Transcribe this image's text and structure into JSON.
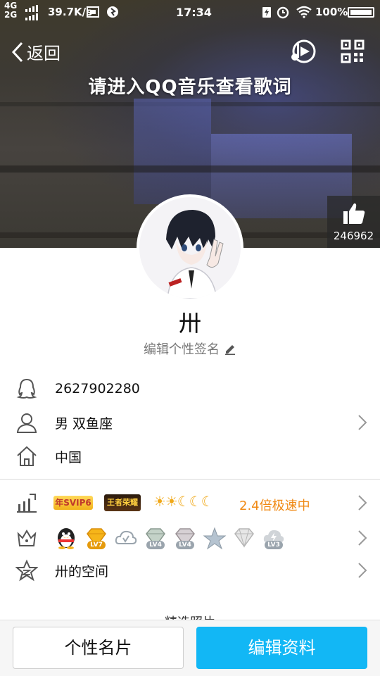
{
  "status_bar": {
    "network_top": "4G",
    "network_bottom": "2G",
    "speed": "39.7K/s",
    "time": "17:34",
    "battery": "100%"
  },
  "nav": {
    "back_label": "返回"
  },
  "header": {
    "lyric_prompt": "请进入QQ音乐查看歌词",
    "like_count": "246962"
  },
  "profile": {
    "nickname": "卅",
    "signature_prompt": "编辑个性签名"
  },
  "info": {
    "qq_number": "2627902280",
    "gender_zodiac": "男  双鱼座",
    "location": "中国"
  },
  "privileges": {
    "svip_badge": "年SVIP6",
    "game_badge": "王者荣耀",
    "level_icons": "☀☀☾☾☾",
    "speed_text": "2.4倍极速中"
  },
  "vip_gems": [
    {
      "level": "LV7",
      "color": "#f0a818"
    },
    {
      "level": "",
      "color": "#9aa4ad"
    },
    {
      "level": "LV4",
      "color": "#9aa4ad"
    },
    {
      "level": "LV4",
      "color": "#9aa4ad"
    },
    {
      "level": "",
      "color": "#9aa4ad"
    },
    {
      "level": "",
      "color": "#b6b6b6"
    },
    {
      "level": "LV3",
      "color": "#9aa4ad"
    }
  ],
  "space": {
    "label": "卅的空间"
  },
  "section": {
    "title": "· 精选照片 ·"
  },
  "bottom": {
    "card_button": "个性名片",
    "edit_button": "编辑资料"
  },
  "colors": {
    "accent": "#12b7f5",
    "vip_orange": "#f08a15"
  }
}
